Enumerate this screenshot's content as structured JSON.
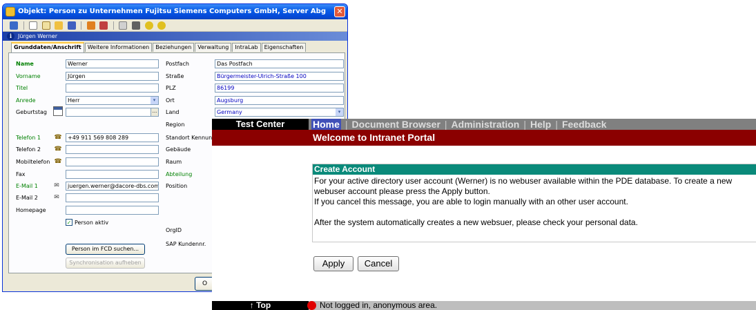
{
  "dialog": {
    "title": "Objekt: Person zu Unternehmen Fujitsu Siemens Computers GmbH, Server Abg",
    "close_glyph": "✕",
    "user": "Jürgen Werner",
    "info_glyph": "i",
    "tabs": [
      "Grunddaten/Anschrift",
      "Weitere Informationen",
      "Beziehungen",
      "Verwaltung",
      "IntraLab",
      "Eigenschaften"
    ],
    "left": {
      "name_label": "Name",
      "name_value": "Werner",
      "vorname_label": "Vorname",
      "vorname_value": "Jürgen",
      "titel_label": "Titel",
      "anrede_label": "Anrede",
      "anrede_value": "Herr",
      "geburtstag_label": "Geburtstag",
      "dots": "...",
      "telefon1_label": "Telefon 1",
      "telefon1_value": "+49 911 569 808 289",
      "telefon2_label": "Telefon 2",
      "mobil_label": "Mobiltelefon",
      "fax_label": "Fax",
      "email1_label": "E-Mail 1",
      "email1_value": "juergen.werner@dacore-dbs.com",
      "email2_label": "E-Mail 2",
      "homepage_label": "Homepage",
      "person_aktiv_label": "Person aktiv",
      "check_glyph": "✓",
      "search_button": "Person im FCD suchen...",
      "sync_button": "Synchronisation aufheben"
    },
    "right": {
      "postfach_label": "Postfach",
      "postfach_value": "Das Postfach",
      "strasse_label": "Straße",
      "strasse_value": "Bürgermeister-Ulrich-Straße 100",
      "plz_label": "PLZ",
      "plz_value": "86199",
      "ort_label": "Ort",
      "ort_value": "Augsburg",
      "land_label": "Land",
      "land_value": "Germany",
      "region_label": "Region",
      "standort_label": "Standort Kennung",
      "gebaeude_label": "Gebäude",
      "raum_label": "Raum",
      "abteilung_label": "Abteilung",
      "position_label": "Position",
      "orgid_label": "OrgID",
      "sap_label": "SAP Kundennr."
    },
    "ok_partial": "O",
    "arrow_glyph": "▾"
  },
  "portal": {
    "brand": "Test Center",
    "nav_items": [
      "Home",
      "Document Browser",
      "Administration",
      "Help",
      "Feedback"
    ],
    "separator": "|",
    "banner_title": "Welcome to Intranet Portal",
    "create_account": {
      "heading": "Create Account",
      "line1": "For your active directory user account (Werner) is no webuser available within the PDE database. To create a new",
      "line2": "webuser account please press the Apply button.",
      "line3": "If you cancel this message, you are able to login manually with an other user account.",
      "line4": "After the system automatically creates a new websuer, please check your personal data."
    },
    "apply_button": "Apply",
    "cancel_button": "Cancel",
    "footer_top": "↑ Top",
    "footer_status": "Not logged in, anonymous area."
  }
}
